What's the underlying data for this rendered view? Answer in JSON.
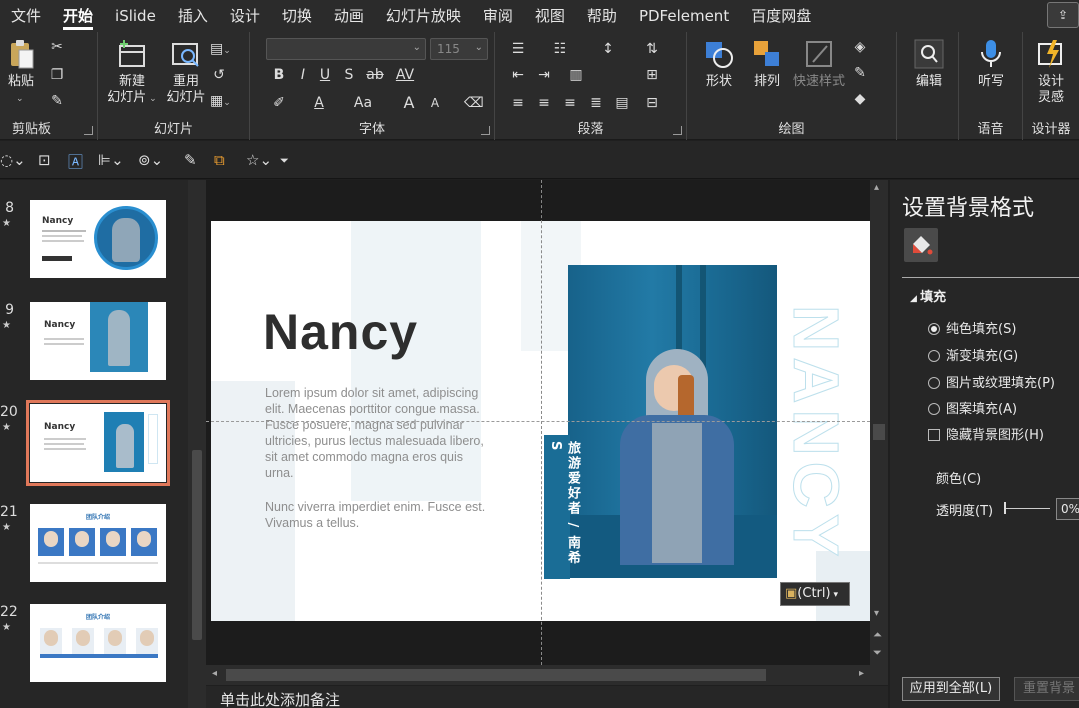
{
  "menu": {
    "tabs": [
      "文件",
      "开始",
      "iSlide",
      "插入",
      "设计",
      "切换",
      "动画",
      "幻灯片放映",
      "审阅",
      "视图",
      "帮助",
      "PDFelement",
      "百度网盘"
    ],
    "active": "开始"
  },
  "ribbon": {
    "clipboard": {
      "paste": "粘贴",
      "label": "剪贴板"
    },
    "slides": {
      "new_slide_line1": "新建",
      "new_slide_line2": "幻灯片",
      "reuse_line1": "重用",
      "reuse_line2": "幻灯片",
      "label": "幻灯片"
    },
    "font": {
      "size_placeholder": "115",
      "label": "字体",
      "bold": "B",
      "italic": "I",
      "underline": "U",
      "shadow": "S",
      "strike": "ab",
      "spacing": "AV",
      "case": "Aa",
      "grow": "A",
      "shrink": "A"
    },
    "paragraph": {
      "label": "段落"
    },
    "drawing": {
      "shapes": "形状",
      "arrange": "排列",
      "quick_styles": "快速样式",
      "label": "绘图"
    },
    "editing": {
      "edit": "编辑"
    },
    "voice": {
      "dictate": "听写",
      "label": "语音"
    },
    "designer": {
      "design_line1": "设计",
      "design_line2": "灵感",
      "label": "设计器"
    }
  },
  "thumbnails": [
    {
      "num": "8",
      "title": "Nancy",
      "variant": "circle"
    },
    {
      "num": "9",
      "title": "Nancy",
      "variant": "photo-right"
    },
    {
      "num": "20",
      "title": "Nancy",
      "variant": "photo-blue",
      "selected": true
    },
    {
      "num": "21",
      "title": "团队介绍",
      "variant": "team"
    },
    {
      "num": "22",
      "title": "团队介绍",
      "variant": "team2"
    }
  ],
  "slide": {
    "title": "Nancy",
    "body1": "Lorem ipsum dolor sit amet, adipiscing elit. Maecenas porttitor congue massa. Fusce posuere, magna sed pulvinar ultricies, purus lectus malesuada libero, sit amet commodo magna eros quis urna.",
    "body1_lines": [
      "Lorem ipsum dolor sit amet, adipiscing",
      "elit. Maecenas porttitor congue massa.",
      "Fusce posuere, magna sed pulvinar",
      "ultricies, purus lectus malesuada libero,",
      "sit amet commodo magna eros quis",
      "urna."
    ],
    "body2_lines": [
      "Nunc viverra imperdiet enim. Fusce est.",
      "Vivamus a tellus."
    ],
    "vertical_label": "旅游爱好者 / 南希S",
    "vertical_outline": "NANCY"
  },
  "paste_option": "(Ctrl)",
  "notes_placeholder": "单击此处添加备注",
  "format_pane": {
    "title": "设置背景格式",
    "section": "填充",
    "options": [
      {
        "label": "纯色填充(S)",
        "checked": true
      },
      {
        "label": "渐变填充(G)",
        "checked": false
      },
      {
        "label": "图片或纹理填充(P)",
        "checked": false
      },
      {
        "label": "图案填充(A)",
        "checked": false
      }
    ],
    "hide_bg": "隐藏背景图形(H)",
    "color_label": "颜色(C)",
    "transparency_label": "透明度(T)",
    "transparency_value": "0%",
    "apply_all": "应用到全部(L)",
    "reset": "重置背景"
  }
}
